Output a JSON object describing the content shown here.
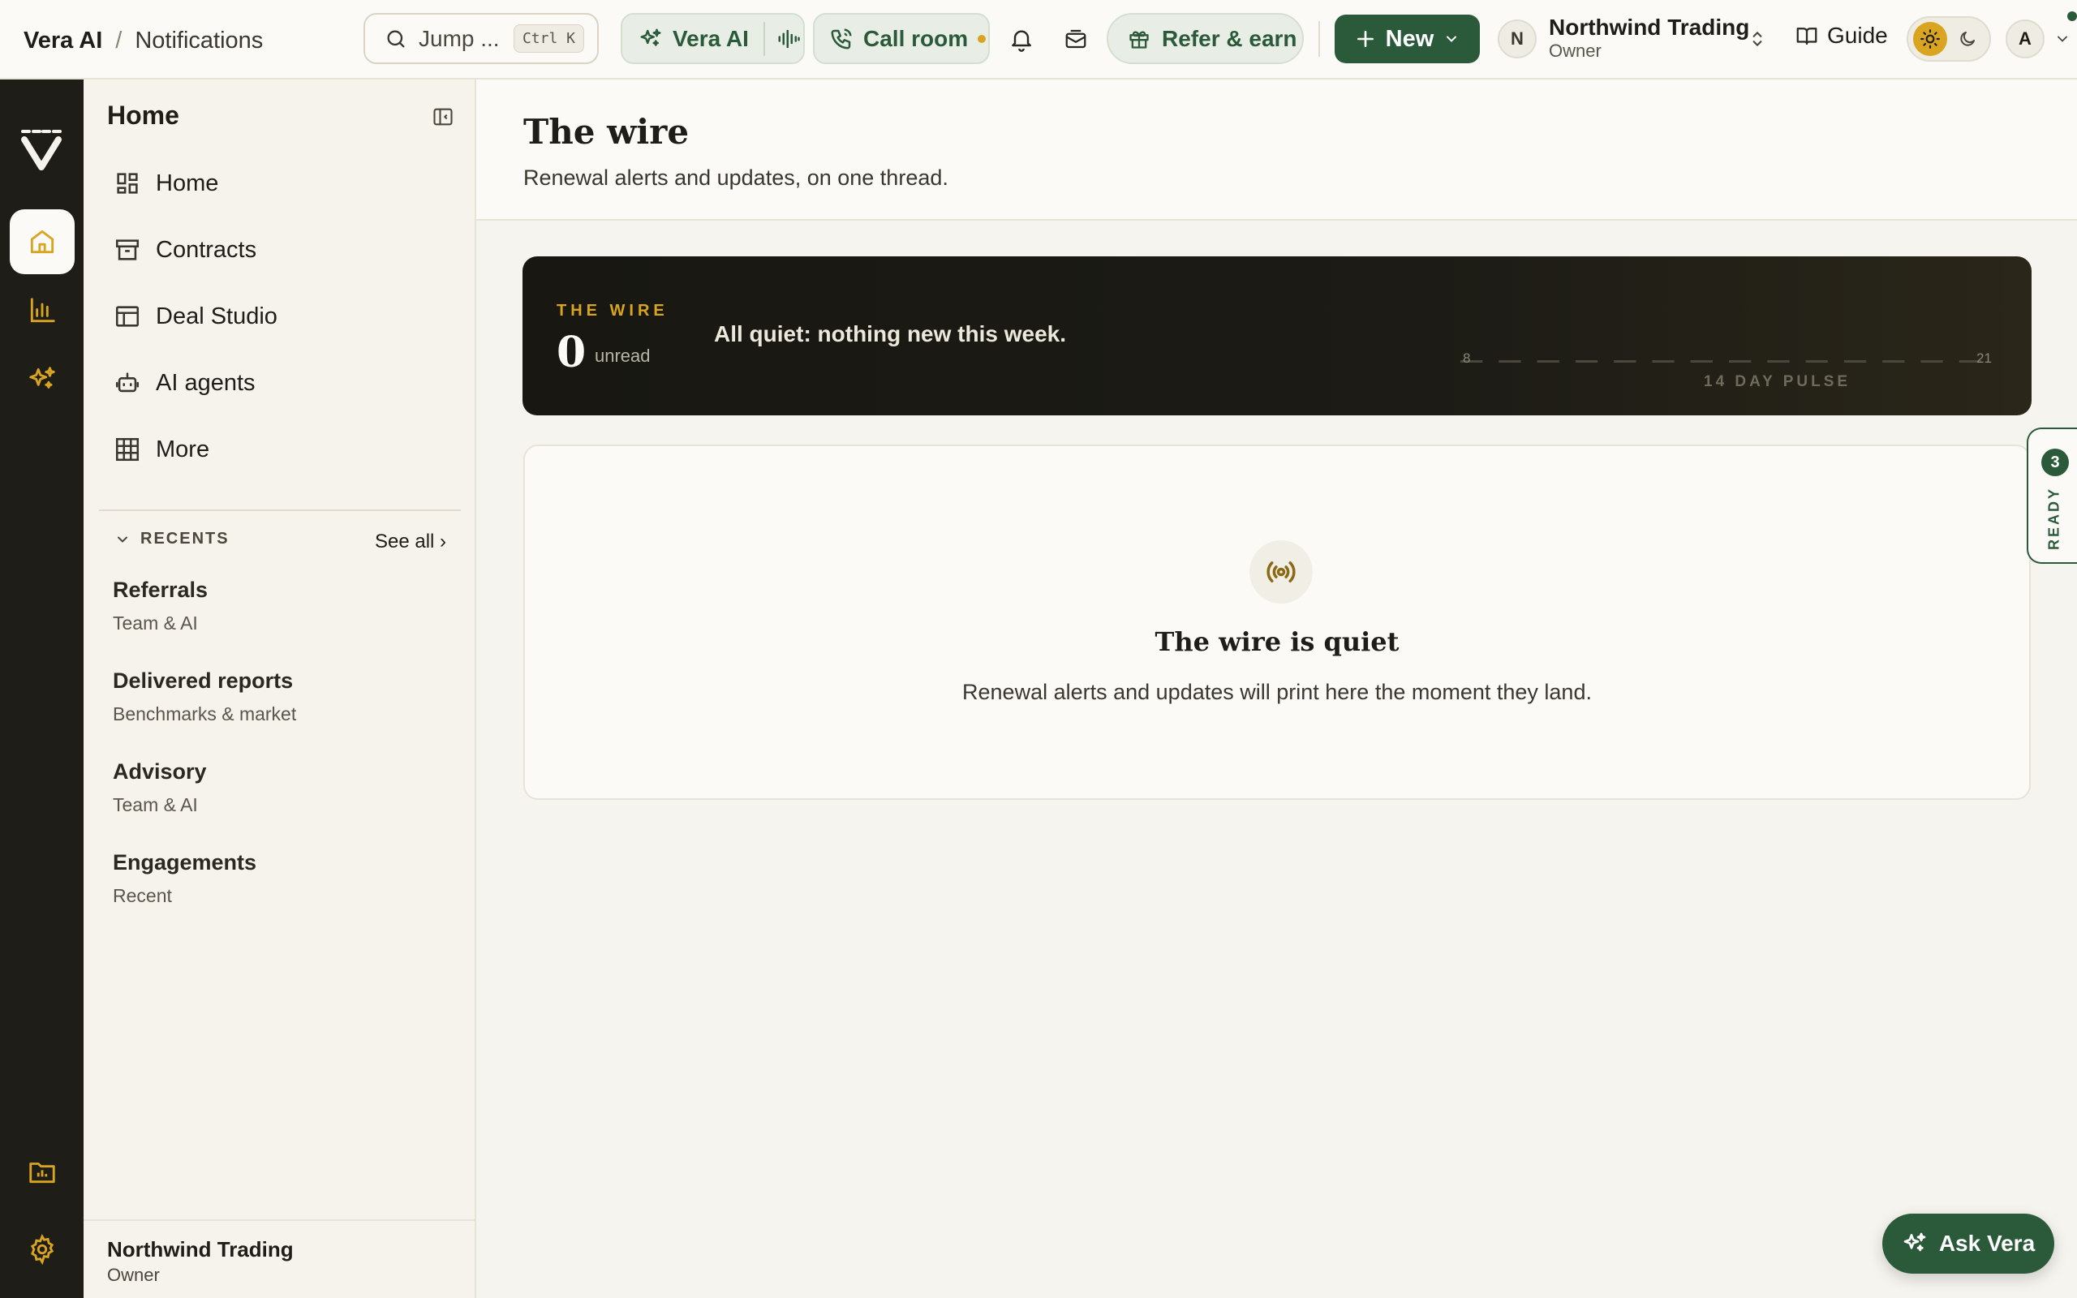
{
  "breadcrumb": {
    "app": "Vera AI",
    "separator": "/",
    "page": "Notifications"
  },
  "search": {
    "label": "Jump ...",
    "shortcut": "Ctrl K"
  },
  "topbar": {
    "vera_ai_label": "Vera AI",
    "call_room_label": "Call room",
    "refer_label": "Refer & earn",
    "new_label": "New",
    "org": {
      "initial": "N",
      "name": "Northwind Trading",
      "role": "Owner"
    },
    "guide_label": "Guide",
    "user_initial": "A"
  },
  "icons": {
    "search": "search-icon",
    "vera_ai": "sparkles-icon",
    "voice": "waveform-icon",
    "call": "phone-icon",
    "bell": "bell-icon",
    "inbox": "inbox-icon",
    "gift": "gift-icon",
    "plus": "plus-icon",
    "book": "book-icon",
    "sun": "sun-icon",
    "moon": "moon-icon"
  },
  "rail": {
    "items": [
      {
        "name": "home",
        "icon": "home-icon",
        "active": true
      },
      {
        "name": "analytics",
        "icon": "bar-chart-icon",
        "active": false
      },
      {
        "name": "ai",
        "icon": "sparkles-icon",
        "active": false
      },
      {
        "name": "files",
        "icon": "folder-chart-icon",
        "active": false
      },
      {
        "name": "settings",
        "icon": "gear-icon",
        "active": false
      }
    ]
  },
  "sidebar": {
    "title": "Home",
    "nav": [
      {
        "label": "Home",
        "icon": "dashboard-icon"
      },
      {
        "label": "Contracts",
        "icon": "archive-icon"
      },
      {
        "label": "Deal Studio",
        "icon": "layout-icon"
      },
      {
        "label": "AI agents",
        "icon": "bot-icon"
      },
      {
        "label": "More",
        "icon": "grid-icon"
      }
    ],
    "recents_label": "RECENTS",
    "see_all": "See all ›",
    "recents": [
      {
        "title": "Referrals",
        "subtitle": "Team & AI"
      },
      {
        "title": "Delivered reports",
        "subtitle": "Benchmarks & market"
      },
      {
        "title": "Advisory",
        "subtitle": "Team & AI"
      },
      {
        "title": "Engagements",
        "subtitle": "Recent"
      }
    ],
    "footer": {
      "name": "Northwind Trading",
      "role": "Owner"
    }
  },
  "page": {
    "title": "The wire",
    "subtitle": "Renewal alerts and updates, on one thread."
  },
  "wire": {
    "label": "THE WIRE",
    "count": "0",
    "unread_label": "unread",
    "message": "All quiet: nothing new this week.",
    "pulse": {
      "label": "14 DAY PULSE",
      "start_tick": "8",
      "end_tick": "21",
      "values": [
        0,
        0,
        0,
        0,
        0,
        0,
        0,
        0,
        0,
        0,
        0,
        0,
        0,
        0
      ]
    }
  },
  "empty": {
    "icon": "broadcast-icon",
    "title": "The wire is quiet",
    "subtitle": "Renewal alerts and updates will print here the moment they land."
  },
  "ready": {
    "count": "3",
    "label": "READY"
  },
  "ask_vera": {
    "label": "Ask Vera"
  },
  "colors": {
    "brand_green": "#2b5a3b",
    "accent_gold": "#d9a520",
    "rail_dark": "#1f1d17"
  }
}
